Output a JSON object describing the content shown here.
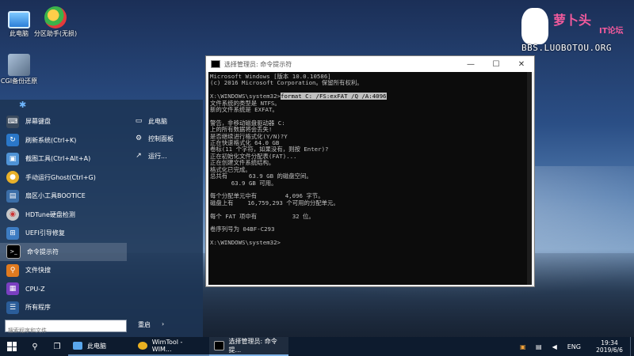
{
  "desktop": {
    "icons": [
      {
        "label": "此电脑"
      },
      {
        "label": "分区助手(无损)"
      },
      {
        "label": "CGI备份还原"
      }
    ]
  },
  "logo": {
    "brand": "萝卜头",
    "brand_sub": "IT论坛",
    "url": "BBS.LUOBOTOU.ORG"
  },
  "start_menu": {
    "items": [
      {
        "label": "屏幕键盘",
        "icon": "keyboard-icon"
      },
      {
        "label": "刷新系统(Ctrl+K)",
        "icon": "refresh-icon"
      },
      {
        "label": "截图工具(Ctrl+Alt+A)",
        "icon": "screenshot-icon"
      },
      {
        "label": "手动运行Ghost(Ctrl+G)",
        "icon": "ghost-icon"
      },
      {
        "label": "扇区小工具BOOTICE",
        "icon": "bootice-icon"
      },
      {
        "label": "HDTune硬盘检测",
        "icon": "hdtune-icon"
      },
      {
        "label": "UEFI引导修复",
        "icon": "uefi-icon"
      },
      {
        "label": "命令提示符",
        "icon": "cmd-icon"
      },
      {
        "label": "文件快搜",
        "icon": "search-file-icon"
      },
      {
        "label": "CPU-Z",
        "icon": "cpu-icon"
      },
      {
        "label": "所有程序",
        "icon": "all-programs-icon"
      }
    ],
    "right_items": [
      {
        "label": "此电脑",
        "icon": "computer-icon"
      },
      {
        "label": "控制面板",
        "icon": "control-panel-icon"
      },
      {
        "label": "运行...",
        "icon": "run-icon"
      }
    ],
    "search_placeholder": "搜索程序和文件",
    "restart_label": "重启",
    "restart_arrow": "›"
  },
  "cmd_window": {
    "title": "选择管理员: 命令提示符",
    "lines": [
      "Microsoft Windows [版本 10.0.10586]",
      "(c) 2016 Microsoft Corporation。保留所有权利。",
      "",
      "X:\\WINDOWS\\system32>",
      "文件系统的类型是 NTFS。",
      "新的文件系统是 EXFAT。",
      "",
      "警告，非移动磁盘驱动器 C:",
      "上的所有数据将会丢失!",
      "是否继续进行格式化(Y/N)?Y",
      "正在快速格式化 64.0 GB",
      "卷标(11 个字符，如果没有，则按 Enter)?",
      "正在初始化文件分配表(FAT)...",
      "正在创建文件系统结构。",
      "格式化已完成。",
      "总共有      63.9 GB 的磁盘空间。",
      "      63.9 GB 可用。",
      "",
      "每个分配单元中有        4,096 字节。",
      "磁盘上有    16,759,293 个可用的分配单元。",
      "",
      "每个 FAT 项中有          32 位。",
      "",
      "卷序列号为 04BF-C293",
      "",
      "X:\\WINDOWS\\system32>"
    ],
    "highlight_command": "format C: /FS:exFAT /Q /A:4096"
  },
  "taskbar": {
    "apps": [
      {
        "label": "此电脑"
      },
      {
        "label": "WimTool - WIM..."
      },
      {
        "label": "选择管理员: 命令提..."
      }
    ],
    "tray": {
      "lang": "ENG",
      "time": "19:34",
      "date": "2019/6/6"
    }
  },
  "colors": {
    "start_menu_bg": "#1c3454",
    "taskbar_bg": "#0d1b2e",
    "terminal_bg": "#0c0c0c",
    "terminal_fg": "#c0c0c0"
  }
}
